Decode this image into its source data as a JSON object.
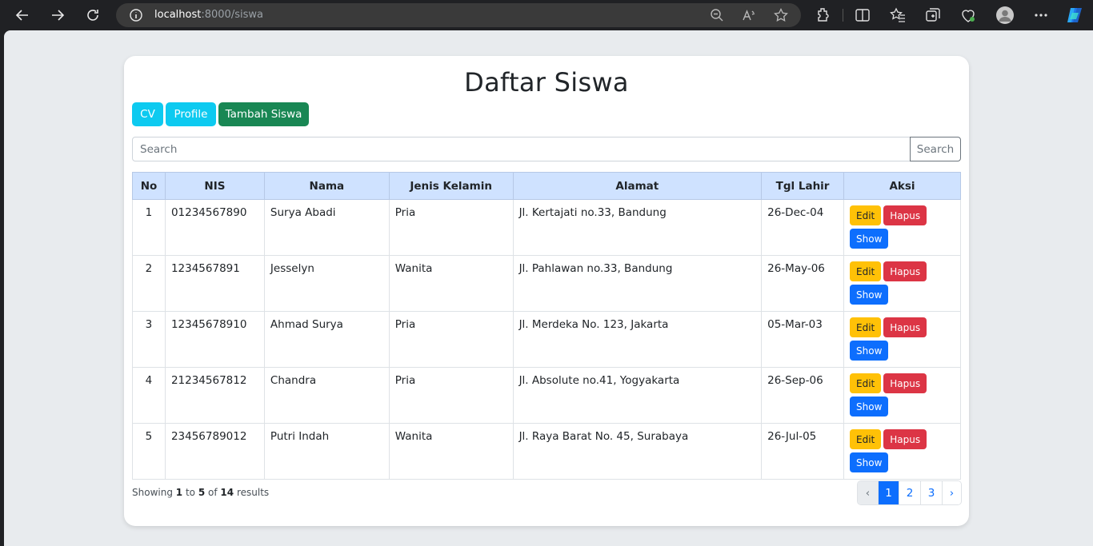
{
  "browser": {
    "url_host": "localhost",
    "url_rest": ":8000/siswa"
  },
  "page": {
    "title": "Daftar Siswa",
    "nav_buttons": {
      "cv": "CV",
      "profile": "Profile",
      "tambah": "Tambah Siswa"
    },
    "search": {
      "placeholder": "Search",
      "button": "Search"
    },
    "table": {
      "headers": [
        "No",
        "NIS",
        "Nama",
        "Jenis Kelamin",
        "Alamat",
        "Tgl Lahir",
        "Aksi"
      ],
      "rows": [
        {
          "no": "1",
          "nis": "01234567890",
          "nama": "Surya Abadi",
          "jk": "Pria",
          "alamat": "Jl. Kertajati no.33, Bandung",
          "tgl": "26-Dec-04"
        },
        {
          "no": "2",
          "nis": "1234567891",
          "nama": "Jesselyn",
          "jk": "Wanita",
          "alamat": "Jl. Pahlawan no.33, Bandung",
          "tgl": "26-May-06"
        },
        {
          "no": "3",
          "nis": "12345678910",
          "nama": "Ahmad Surya",
          "jk": "Pria",
          "alamat": "Jl. Merdeka No. 123, Jakarta",
          "tgl": "05-Mar-03"
        },
        {
          "no": "4",
          "nis": "21234567812",
          "nama": "Chandra",
          "jk": "Pria",
          "alamat": "Jl. Absolute no.41, Yogyakarta",
          "tgl": "26-Sep-06"
        },
        {
          "no": "5",
          "nis": "23456789012",
          "nama": "Putri Indah",
          "jk": "Wanita",
          "alamat": "Jl. Raya Barat No. 45, Surabaya",
          "tgl": "26-Jul-05"
        }
      ],
      "actions": {
        "edit": "Edit",
        "hapus": "Hapus",
        "show": "Show"
      }
    },
    "showing": {
      "prefix": "Showing",
      "from": "1",
      "to_word": "to",
      "to": "5",
      "of_word": "of",
      "total": "14",
      "suffix": "results"
    },
    "pagination": {
      "prev": "‹",
      "pages": [
        "1",
        "2",
        "3"
      ],
      "next": "›"
    }
  },
  "colors": {
    "primary": "#0d6efd",
    "info": "#0dcaf0",
    "success": "#198754",
    "warning": "#ffc107",
    "danger": "#dc3545",
    "table_header": "#cfe2ff"
  }
}
